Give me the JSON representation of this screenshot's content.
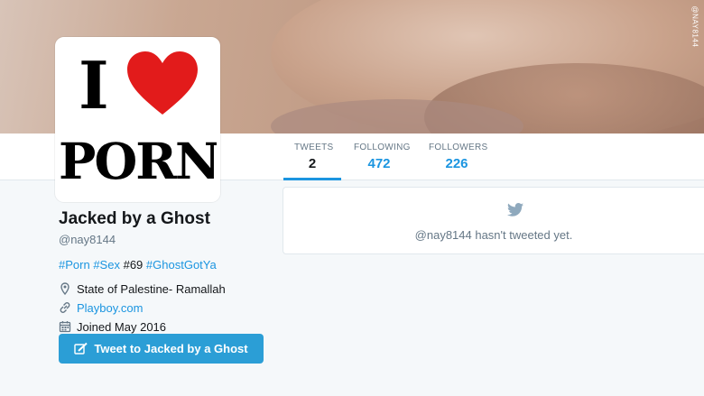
{
  "watermark": "@NAY8144",
  "avatar": {
    "line1": "I",
    "line2": "PORN"
  },
  "stats": {
    "tweets": {
      "label": "TWEETS",
      "value": "2"
    },
    "following": {
      "label": "FOLLOWING",
      "value": "472"
    },
    "followers": {
      "label": "FOLLOWERS",
      "value": "226"
    }
  },
  "profile": {
    "name": "Jacked by a Ghost",
    "handle": "@nay8144",
    "bio": {
      "tag1": "#Porn",
      "tag2": "#Sex",
      "plain": "#69",
      "tag3": "#GhostGotYa"
    },
    "location": "State of Palestine- Ramallah",
    "website": "Playboy.com",
    "joined": "Joined May 2016"
  },
  "tweet_button": {
    "label": "Tweet to Jacked by a Ghost"
  },
  "timeline": {
    "empty_text": "@nay8144 hasn't tweeted yet."
  },
  "colors": {
    "accent": "#1b95e0",
    "button": "#2b9ed6",
    "heart": "#e21b1b"
  }
}
